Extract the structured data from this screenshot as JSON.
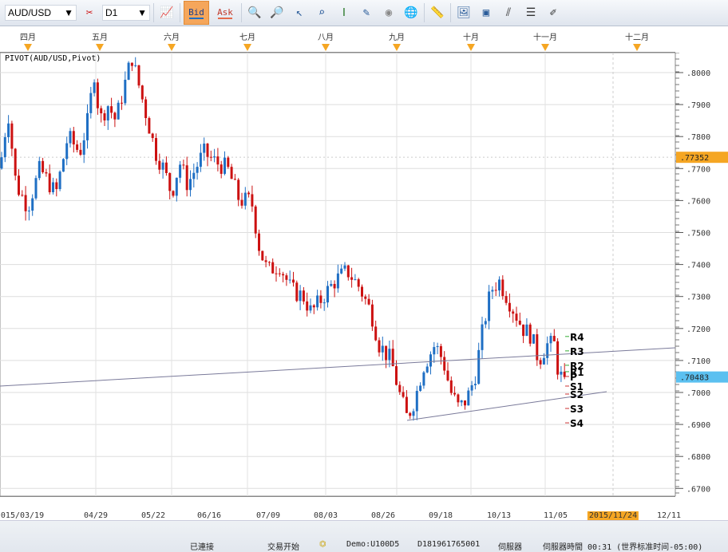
{
  "toolbar": {
    "symbol": "AUD/USD",
    "timeframe": "D1",
    "bid_label": "Bid",
    "ask_label": "Ask"
  },
  "months": [
    "四月",
    "五月",
    "六月",
    "七月",
    "八月",
    "九月",
    "十月",
    "十一月",
    "十二月"
  ],
  "indicator_label": "PIVOT(AUD/USD,Pivot)",
  "price_axis": {
    "ticks": [
      ".8000",
      ".7900",
      ".7800",
      ".7700",
      ".7600",
      ".7500",
      ".7400",
      ".7300",
      ".7200",
      ".7100",
      ".7000",
      ".6900",
      ".6800",
      ".6700"
    ],
    "current_price": ".70483",
    "bid_line_price": ".77352"
  },
  "dates": [
    "015/03/19",
    "04/29",
    "05/22",
    "06/16",
    "07/09",
    "08/03",
    "08/26",
    "09/18",
    "10/13",
    "11/05",
    "2015/11/24",
    "12/11"
  ],
  "pivots": [
    {
      "label": "R4",
      "value": 0.7175
    },
    {
      "label": "R3",
      "value": 0.713
    },
    {
      "label": "R2",
      "value": 0.7085
    },
    {
      "label": "R1",
      "value": 0.7065
    },
    {
      "label": "P",
      "value": 0.705
    },
    {
      "label": "S1",
      "value": 0.702
    },
    {
      "label": "S2",
      "value": 0.6995
    },
    {
      "label": "S3",
      "value": 0.695
    },
    {
      "label": "S4",
      "value": 0.6905
    }
  ],
  "price_path": [
    [
      0,
      0.77
    ],
    [
      10,
      0.788
    ],
    [
      20,
      0.765
    ],
    [
      35,
      0.758
    ],
    [
      50,
      0.77
    ],
    [
      70,
      0.762
    ],
    [
      85,
      0.78
    ],
    [
      100,
      0.775
    ],
    [
      110,
      0.785
    ],
    [
      118,
      0.8
    ],
    [
      125,
      0.785
    ],
    [
      135,
      0.79
    ],
    [
      145,
      0.785
    ],
    [
      155,
      0.795
    ],
    [
      165,
      0.805
    ],
    [
      175,
      0.795
    ],
    [
      185,
      0.785
    ],
    [
      195,
      0.775
    ],
    [
      205,
      0.77
    ],
    [
      215,
      0.762
    ],
    [
      225,
      0.772
    ],
    [
      235,
      0.765
    ],
    [
      245,
      0.77
    ],
    [
      255,
      0.775
    ],
    [
      270,
      0.772
    ],
    [
      285,
      0.77
    ],
    [
      300,
      0.76
    ],
    [
      315,
      0.76
    ],
    [
      325,
      0.745
    ],
    [
      335,
      0.738
    ],
    [
      350,
      0.74
    ],
    [
      365,
      0.732
    ],
    [
      380,
      0.73
    ],
    [
      390,
      0.725
    ],
    [
      405,
      0.73
    ],
    [
      420,
      0.735
    ],
    [
      435,
      0.738
    ],
    [
      450,
      0.733
    ],
    [
      465,
      0.725
    ],
    [
      475,
      0.715
    ],
    [
      490,
      0.71
    ],
    [
      500,
      0.7
    ],
    [
      510,
      0.692
    ],
    [
      520,
      0.698
    ],
    [
      530,
      0.708
    ],
    [
      545,
      0.715
    ],
    [
      555,
      0.71
    ],
    [
      565,
      0.7
    ],
    [
      575,
      0.695
    ],
    [
      585,
      0.698
    ],
    [
      595,
      0.705
    ],
    [
      605,
      0.72
    ],
    [
      615,
      0.732
    ],
    [
      625,
      0.735
    ],
    [
      635,
      0.73
    ],
    [
      645,
      0.725
    ],
    [
      655,
      0.72
    ],
    [
      665,
      0.718
    ],
    [
      675,
      0.71
    ],
    [
      685,
      0.715
    ],
    [
      695,
      0.715
    ],
    [
      700,
      0.705
    ],
    [
      710,
      0.7048
    ]
  ],
  "status": {
    "connection": "已連接",
    "trading": "交易开始",
    "account": "Demo:U100D5",
    "id": "D181961765001",
    "server": "伺服器",
    "server_time": "伺服器時間 00:31 (世界标准时间-05:00)"
  },
  "colors": {
    "up": "#1f6fc4",
    "down": "#cc1111",
    "accent": "#f5a623",
    "current": "#5bc0f0"
  }
}
